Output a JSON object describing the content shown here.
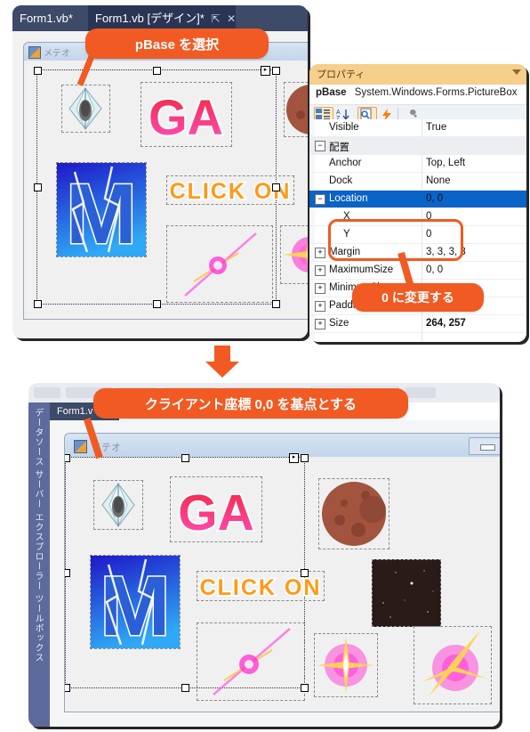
{
  "top_window": {
    "tabs": [
      {
        "label": "Form1.vb*",
        "active": false
      },
      {
        "label": "Form1.vb [デザイン]*",
        "active": true,
        "pin": "⇱",
        "close": "✕"
      }
    ],
    "form": {
      "title": "メテオ",
      "icon": "form-icon"
    }
  },
  "callouts": {
    "select_pbase": "pBase を選択",
    "change_to_zero": "0 に変更する",
    "client_origin": "クライアント座標 0,0 を基点とする"
  },
  "properties": {
    "title": "プロパティ",
    "object_name": "pBase",
    "object_type": "System.Windows.Forms.PictureBox",
    "toolbar": [
      {
        "name": "categorized-button",
        "state": "on"
      },
      {
        "name": "alphabetical-button",
        "state": "off"
      },
      {
        "name": "properties-button",
        "state": "on"
      },
      {
        "name": "events-button",
        "state": "off"
      },
      {
        "name": "property-pages-button",
        "state": "off"
      }
    ],
    "rows": [
      {
        "name": "Visible",
        "value": "True",
        "kind": "prop",
        "expander": "",
        "indent": false
      },
      {
        "name": "配置",
        "value": "",
        "kind": "category",
        "expander": "−",
        "indent": false
      },
      {
        "name": "Anchor",
        "value": "Top, Left",
        "kind": "prop",
        "expander": "",
        "indent": false
      },
      {
        "name": "Dock",
        "value": "None",
        "kind": "prop",
        "expander": "",
        "indent": false
      },
      {
        "name": "Location",
        "value": "0, 0",
        "kind": "selected",
        "expander": "−",
        "indent": false
      },
      {
        "name": "X",
        "value": "0",
        "kind": "prop",
        "expander": "",
        "indent": true
      },
      {
        "name": "Y",
        "value": "0",
        "kind": "prop",
        "expander": "",
        "indent": true
      },
      {
        "name": "Margin",
        "value": "3, 3, 3, 3",
        "kind": "prop",
        "expander": "+",
        "indent": false
      },
      {
        "name": "MaximumSize",
        "value": "0, 0",
        "kind": "prop",
        "expander": "+",
        "indent": false
      },
      {
        "name": "MinimumSize",
        "value": "",
        "kind": "prop",
        "expander": "+",
        "indent": false
      },
      {
        "name": "Padding",
        "value": "",
        "kind": "prop",
        "expander": "+",
        "indent": false
      },
      {
        "name": "Size",
        "value": "264, 257",
        "kind": "prop",
        "expander": "+",
        "indent": false
      }
    ]
  },
  "bottom_window": {
    "dock_labels": "データソース  サーバー エクスプローラー   ツールボックス",
    "tab_label": "Form1.v",
    "form": {
      "title": "メテオ"
    }
  },
  "colors": {
    "accent_orange": "#f15a22",
    "tab_dark": "#3d4a68",
    "tab_active": "#2a3555",
    "props_title": "#f5cf8b",
    "selection_blue": "#0a64c8",
    "dock_blue": "#5c6a9c"
  },
  "images": {
    "ship": "ship-thumbnail",
    "ga": "ga-logo-thumbnail",
    "m": "m-logo-thumbnail",
    "click": "click-on-thumbnail",
    "planet": "planet-thumbnail",
    "space": "starfield-thumbnail",
    "beam": "beam-thumbnail",
    "burst": "burst-thumbnail"
  }
}
